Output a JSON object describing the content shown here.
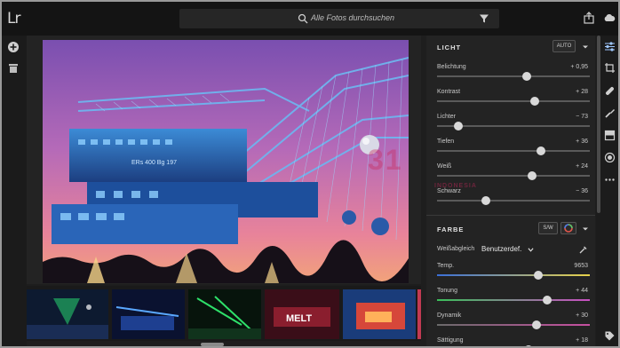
{
  "app": {
    "logo": "Lr"
  },
  "search": {
    "placeholder": "Alle Fotos durchsuchen"
  },
  "icons": {
    "add": "plus-circle-icon",
    "library": "album-icon",
    "search": "search-icon",
    "filter": "funnel-icon",
    "share": "share-icon",
    "cloud": "cloud-icon",
    "edit": "sliders-icon",
    "crop": "crop-icon",
    "heal": "bandage-icon",
    "brush": "brush-icon",
    "gradient": "gradient-icon",
    "radial": "radial-icon",
    "more": "more-icon"
  },
  "light": {
    "title": "LICHT",
    "auto_label": "AUTO",
    "sliders": [
      {
        "label": "Belichtung",
        "value": "+ 0,95",
        "pos": 0.59
      },
      {
        "label": "Kontrast",
        "value": "+ 28",
        "pos": 0.64
      },
      {
        "label": "Lichter",
        "value": "− 73",
        "pos": 0.14
      },
      {
        "label": "Tiefen",
        "value": "+ 36",
        "pos": 0.68
      },
      {
        "label": "Weiß",
        "value": "+ 24",
        "pos": 0.62
      },
      {
        "label": "Schwarz",
        "value": "− 36",
        "pos": 0.32
      }
    ]
  },
  "color": {
    "title": "FARBE",
    "bw_label": "S/W",
    "wb_label": "Weißabgleich",
    "wb_value": "Benutzerdef.",
    "sliders": [
      {
        "label": "Temp.",
        "value": "9653",
        "pos": 0.66
      },
      {
        "label": "Tonung",
        "value": "+ 44",
        "pos": 0.72
      },
      {
        "label": "Dynamik",
        "value": "+ 30",
        "pos": 0.65
      },
      {
        "label": "Sättigung",
        "value": "+ 18",
        "pos": 0.6
      }
    ]
  },
  "photo": {
    "sign_text": "ERs 400 Bg 197"
  },
  "filmstrip": {
    "thumb4_text": "MELT"
  },
  "watermark": {
    "text": "31",
    "sub": "INDONESIA"
  },
  "colors": {
    "accent": "#4a90d9",
    "bg": "#1e1e1e",
    "panel": "#232323"
  }
}
